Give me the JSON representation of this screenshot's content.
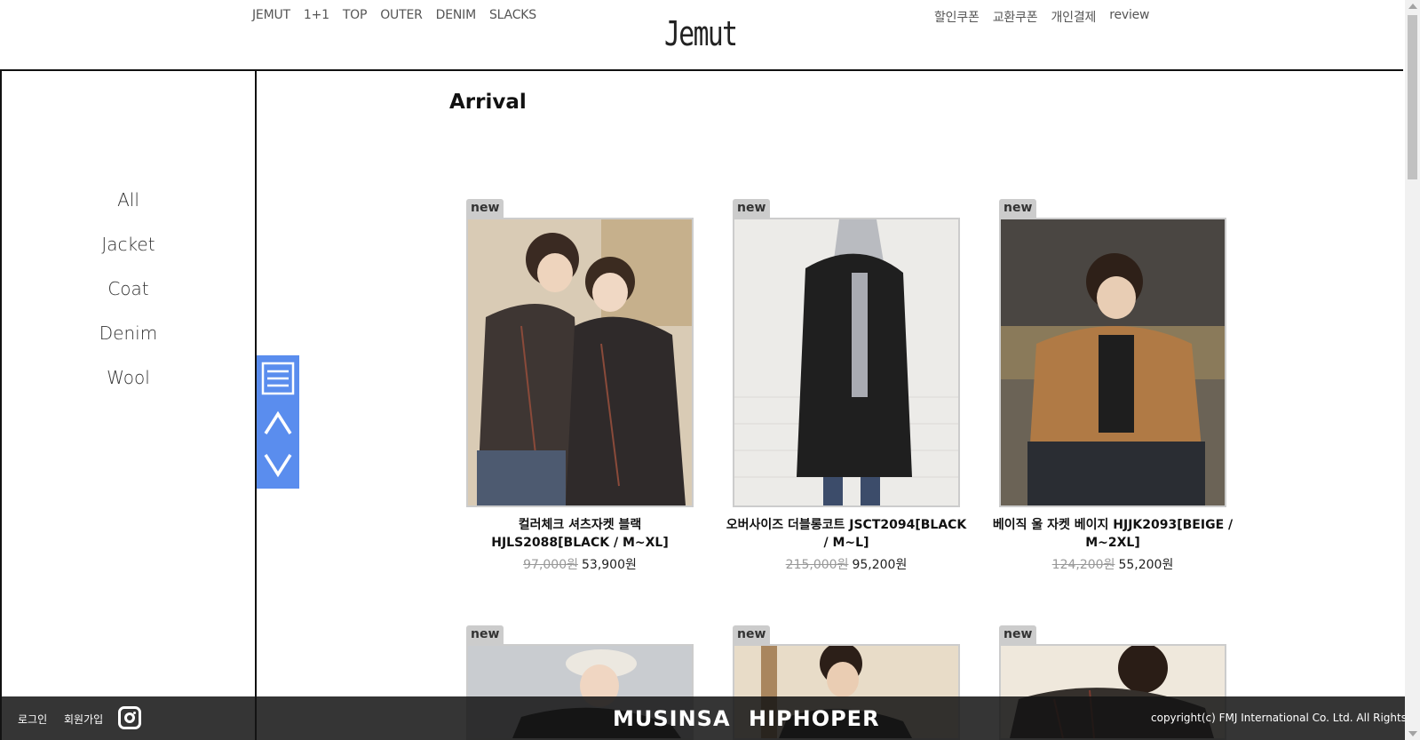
{
  "header": {
    "logo": "Jemut",
    "nav_left": [
      "JEMUT",
      "1+1",
      "TOP",
      "OUTER",
      "DENIM",
      "SLACKS"
    ],
    "nav_right": [
      "할인쿠폰",
      "교환쿠폰",
      "개인결제",
      "review"
    ]
  },
  "sidebar": {
    "categories": [
      "All",
      "Jacket",
      "Coat",
      "Denim",
      "Wool"
    ]
  },
  "main": {
    "title": "Arrival",
    "products": [
      {
        "badge": "new",
        "name": "컬러체크 셔츠자켓 블랙 HJLS2088[BLACK / M~XL]",
        "old_price": "97,000원",
        "price": "53,900원"
      },
      {
        "badge": "new",
        "name": "오버사이즈 더블롱코트 JSCT2094[BLACK / M~L]",
        "old_price": "215,000원",
        "price": "95,200원"
      },
      {
        "badge": "new",
        "name": "베이직 울 자켓 베이지 HJJK2093[BEIGE / M~2XL]",
        "old_price": "124,200원",
        "price": "55,200원"
      },
      {
        "badge": "new"
      },
      {
        "badge": "new"
      },
      {
        "badge": "new"
      }
    ]
  },
  "footer": {
    "login": "로그인",
    "signup": "회원가입",
    "brands": [
      "MUSINSA",
      "HIPHOPER"
    ],
    "copyright": "copyright(c) FMJ International Co. Ltd. All Rights Reserved."
  },
  "colors": {
    "float_panel": "#5a8dee",
    "footer_bg": "#141414"
  },
  "icons": [
    "menu-icon",
    "arrow-up-icon",
    "arrow-down-icon",
    "instagram-icon"
  ]
}
